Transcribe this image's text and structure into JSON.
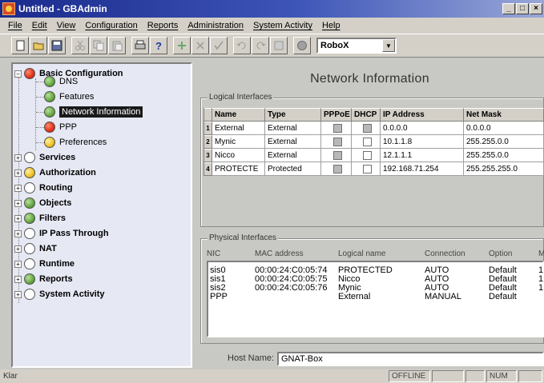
{
  "window": {
    "title": "Untitled - GBAdmin",
    "controls": [
      "_",
      "×"
    ],
    "restore": "□"
  },
  "menu": [
    "File",
    "Edit",
    "View",
    "Configuration",
    "Reports",
    "Administration",
    "System Activity",
    "Help"
  ],
  "toolbar": {
    "device": "RoboX"
  },
  "tree": {
    "nodes": [
      {
        "label": "Basic Configuration",
        "status": "red",
        "bold": true,
        "level": 0,
        "expander": "−"
      },
      {
        "label": "DNS",
        "status": "green",
        "level": 1
      },
      {
        "label": "Features",
        "status": "green",
        "level": 1
      },
      {
        "label": "Network Information",
        "status": "green",
        "level": 1,
        "selected": true
      },
      {
        "label": "PPP",
        "status": "red",
        "level": 1
      },
      {
        "label": "Preferences",
        "status": "yellow",
        "level": 1
      },
      {
        "label": "Services",
        "status": "empty",
        "bold": true,
        "level": 0,
        "expander": "+"
      },
      {
        "label": "Authorization",
        "status": "yellow",
        "bold": true,
        "level": 0,
        "expander": "+"
      },
      {
        "label": "Routing",
        "status": "empty",
        "bold": true,
        "level": 0,
        "expander": "+"
      },
      {
        "label": "Objects",
        "status": "green",
        "bold": true,
        "level": 0,
        "expander": "+"
      },
      {
        "label": "Filters",
        "status": "green",
        "bold": true,
        "level": 0,
        "expander": "+"
      },
      {
        "label": "IP Pass Through",
        "status": "empty",
        "bold": true,
        "level": 0,
        "expander": "+"
      },
      {
        "label": "NAT",
        "status": "empty",
        "bold": true,
        "level": 0,
        "expander": "+"
      },
      {
        "label": "Runtime",
        "status": "empty",
        "bold": true,
        "level": 0,
        "expander": "+"
      },
      {
        "label": "Reports",
        "status": "green",
        "bold": true,
        "level": 0,
        "expander": "+"
      },
      {
        "label": "System Activity",
        "status": "empty",
        "bold": true,
        "level": 0,
        "expander": "+"
      }
    ]
  },
  "main": {
    "title": "Network Information",
    "logical": {
      "legend": "Logical Interfaces",
      "headers": [
        "Name",
        "Type",
        "PPPoE",
        "DHCP",
        "IP Address",
        "Net Mask"
      ],
      "rows": [
        {
          "num": "1",
          "name": "External",
          "type": "External",
          "pppoe": false,
          "dhcp": false,
          "ip": "0.0.0.0",
          "mask": "0.0.0.0"
        },
        {
          "num": "2",
          "name": "Mynic",
          "type": "External",
          "pppoe": false,
          "dhcp": false,
          "ip": "10.1.1.8",
          "mask": "255.255.0.0"
        },
        {
          "num": "3",
          "name": "Nicco",
          "type": "External",
          "pppoe": false,
          "dhcp": false,
          "ip": "12.1.1.1",
          "mask": "255.255.0.0"
        },
        {
          "num": "4",
          "name": "PROTECTE",
          "type": "Protected",
          "pppoe": false,
          "dhcp": false,
          "ip": "192.168.71.254",
          "mask": "255.255.255.0"
        }
      ]
    },
    "physical": {
      "legend": "Physical Interfaces",
      "headers": [
        "NIC",
        "MAC address",
        "Logical name",
        "Connection",
        "Option",
        "M"
      ],
      "rows": [
        {
          "nic": "sis0",
          "mac": "00:00:24:C0:05:74",
          "logical": "PROTECTED",
          "conn": "AUTO",
          "option": "Default",
          "m": "1"
        },
        {
          "nic": "sis1",
          "mac": "00:00:24:C0:05:75",
          "logical": "Nicco",
          "conn": "AUTO",
          "option": "Default",
          "m": "1"
        },
        {
          "nic": "sis2",
          "mac": "00:00:24:C0:05:76",
          "logical": "Mynic",
          "conn": "AUTO",
          "option": "Default",
          "m": "1"
        },
        {
          "nic": "PPP",
          "mac": "",
          "logical": "External",
          "conn": "MANUAL",
          "option": "Default",
          "m": ""
        }
      ]
    },
    "host": {
      "label": "Host Name:",
      "value": "GNAT-Box"
    }
  },
  "status": {
    "text": "Klar",
    "mode": "OFFLINE",
    "num": "NUM"
  }
}
